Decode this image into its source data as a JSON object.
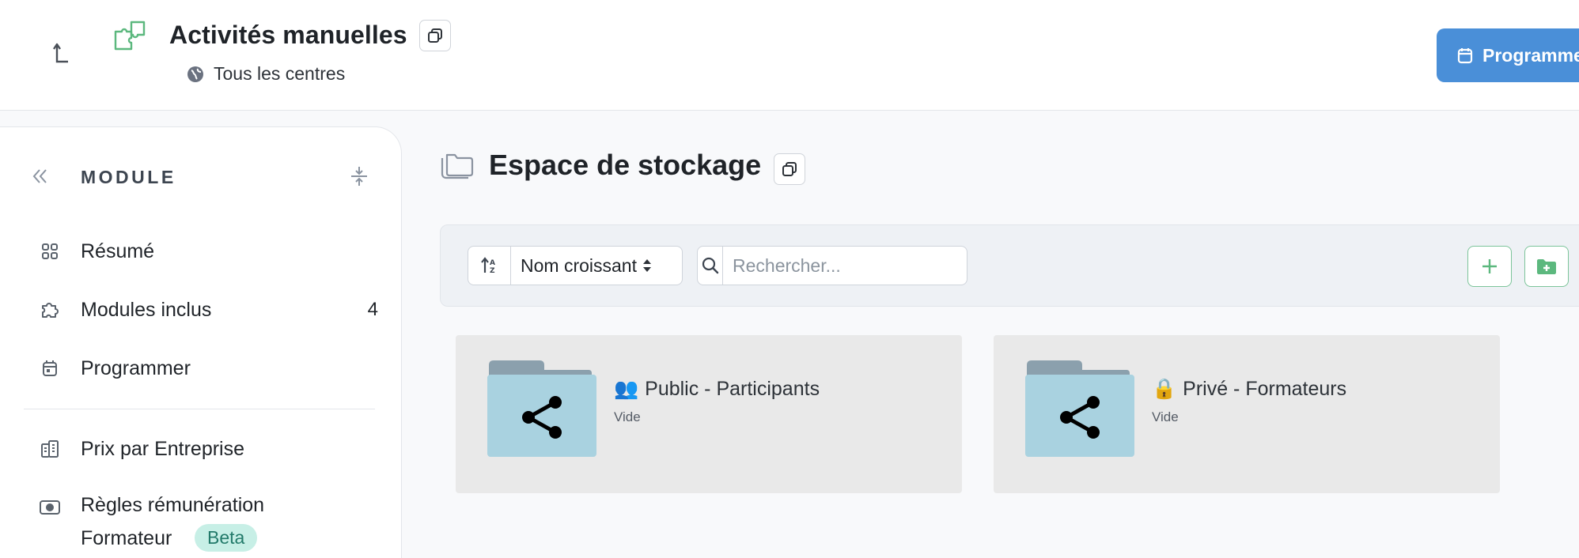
{
  "header": {
    "title": "Activités manuelles",
    "scope": "Tous les centres",
    "schedule_label": "Programmer"
  },
  "sidebar": {
    "header": "MODULE",
    "items": [
      {
        "label": "Résumé",
        "icon": "grid-icon"
      },
      {
        "label": "Modules inclus",
        "icon": "puzzle-icon",
        "count": "4"
      },
      {
        "label": "Programmer",
        "icon": "calendar-icon"
      },
      {
        "label": "Prix par Entreprise",
        "icon": "building-icon"
      },
      {
        "label_line1": "Règles rémunération",
        "label_line2": "Formateur",
        "badge": "Beta",
        "icon": "money-icon"
      }
    ]
  },
  "main": {
    "title": "Espace de stockage",
    "toolbar": {
      "sort_value": "Nom croissant",
      "search_placeholder": "Rechercher..."
    },
    "folders": [
      {
        "name": "Public - Participants",
        "emoji": "👥",
        "status": "Vide"
      },
      {
        "name": "Privé - Formateurs",
        "emoji": "🔒",
        "status": "Vide"
      }
    ]
  },
  "colors": {
    "accent_blue": "#4a8fd8",
    "green": "#5cb87e",
    "folder_light": "#a9d2e0",
    "folder_tab": "#8ba0ad",
    "badge_bg": "#c7efe6"
  }
}
